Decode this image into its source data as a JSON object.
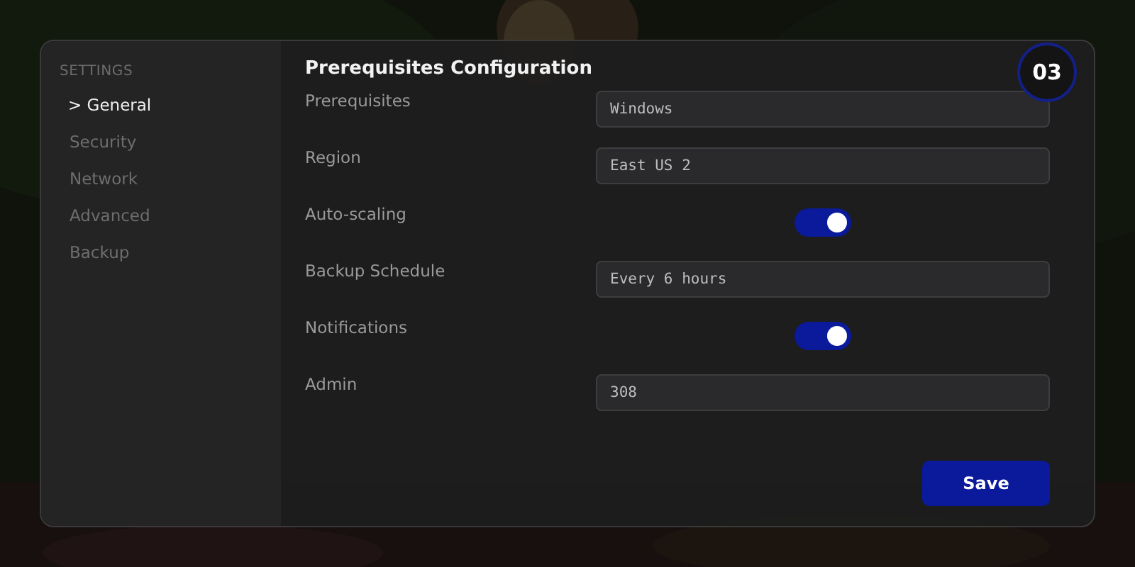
{
  "sidebar": {
    "heading": "SETTINGS",
    "items": [
      {
        "label": "> General",
        "selected": true
      },
      {
        "label": "Security",
        "selected": false
      },
      {
        "label": "Network",
        "selected": false
      },
      {
        "label": "Advanced",
        "selected": false
      },
      {
        "label": "Backup",
        "selected": false
      }
    ]
  },
  "title": "Prerequisites Configuration",
  "step_badge": "03",
  "fields": [
    {
      "kind": "text",
      "label": "Prerequisites",
      "value": "Windows"
    },
    {
      "kind": "text",
      "label": "Region",
      "value": "East US 2"
    },
    {
      "kind": "toggle",
      "label": "Auto-scaling",
      "on": true
    },
    {
      "kind": "text",
      "label": "Backup Schedule",
      "value": "Every 6 hours"
    },
    {
      "kind": "toggle",
      "label": "Notifications",
      "on": true
    },
    {
      "kind": "text",
      "label": "Admin",
      "value": "308"
    }
  ],
  "save_button": "Save"
}
